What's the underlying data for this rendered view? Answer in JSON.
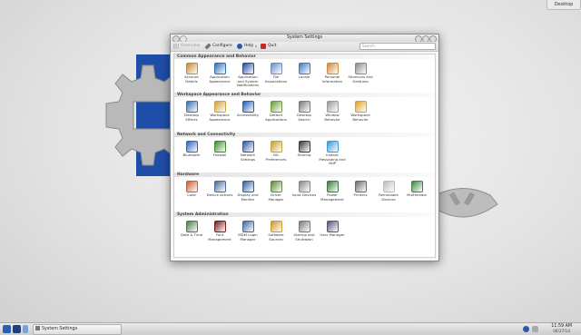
{
  "desktop": {
    "desktop_button": "Desktop"
  },
  "window": {
    "title": "System Settings",
    "toolbar": {
      "overview": "Overview",
      "configure": "Configure",
      "help": "Help",
      "quit": "Quit",
      "search_placeholder": "Search"
    },
    "sections": [
      {
        "title": "Common Appearance and Behavior",
        "items": [
          {
            "label": "Account Details",
            "icon": "user-icon",
            "color": "#c98a2e"
          },
          {
            "label": "Application Appearance",
            "icon": "palette-icon",
            "color": "#2f6eb8"
          },
          {
            "label": "Application and System Notifications",
            "icon": "info-icon",
            "color": "#1c4fa0"
          },
          {
            "label": "File Associations",
            "icon": "file-assoc-icon",
            "color": "#6a8fc7"
          },
          {
            "label": "Locale",
            "icon": "globe-icon",
            "color": "#3a7ac9"
          },
          {
            "label": "Personal Information",
            "icon": "person-icon",
            "color": "#d08a3a"
          },
          {
            "label": "Shortcuts and Gestures",
            "icon": "keyboard-icon",
            "color": "#8a8a8a"
          }
        ]
      },
      {
        "title": "Workspace Appearance and Behavior",
        "items": [
          {
            "label": "Desktop Effects",
            "icon": "desktop-effects-icon",
            "color": "#3c6fb3"
          },
          {
            "label": "Workspace Appearance",
            "icon": "workspace-appearance-icon",
            "color": "#d0a040"
          },
          {
            "label": "Accessibility",
            "icon": "accessibility-icon",
            "color": "#1f5fb8"
          },
          {
            "label": "Default Applications",
            "icon": "default-apps-icon",
            "color": "#6d9a3a"
          },
          {
            "label": "Desktop Search",
            "icon": "magnifier-icon",
            "color": "#7a7a7a"
          },
          {
            "label": "Window Behavior",
            "icon": "window-icon",
            "color": "#9a9a9a"
          },
          {
            "label": "Workspace Behavior",
            "icon": "workspace-behavior-icon",
            "color": "#e0a020"
          }
        ]
      },
      {
        "title": "Network and Connectivity",
        "items": [
          {
            "label": "Bluetooth",
            "icon": "bluetooth-icon",
            "color": "#2b63c4"
          },
          {
            "label": "Firewall",
            "icon": "firewall-icon",
            "color": "#3d8c2e"
          },
          {
            "label": "Network Settings",
            "icon": "network-icon",
            "color": "#2a5aa6"
          },
          {
            "label": "SSL Preferences",
            "icon": "ssl-icon",
            "color": "#c4a030"
          },
          {
            "label": "Sharing",
            "icon": "sharing-icon",
            "color": "#3a3a3a"
          },
          {
            "label": "Instant Messaging and VoIP",
            "icon": "chat-icon",
            "color": "#3a9ad9"
          }
        ]
      },
      {
        "title": "Hardware",
        "items": [
          {
            "label": "Color",
            "icon": "color-icon",
            "color": "#d05a2a"
          },
          {
            "label": "Device Actions",
            "icon": "device-actions-icon",
            "color": "#4a6a9a"
          },
          {
            "label": "Display and Monitor",
            "icon": "monitor-icon",
            "color": "#2a5f9e"
          },
          {
            "label": "Driver Manager",
            "icon": "driver-icon",
            "color": "#5a8a3a"
          },
          {
            "label": "Input Devices",
            "icon": "input-devices-icon",
            "color": "#888888"
          },
          {
            "label": "Power Management",
            "icon": "power-icon",
            "color": "#3a7a3a"
          },
          {
            "label": "Printers",
            "icon": "printer-icon",
            "color": "#6a6a6a"
          },
          {
            "label": "Removable Devices",
            "icon": "removable-icon",
            "color": "#bbbbbb"
          },
          {
            "label": "Multimedia",
            "icon": "multimedia-icon",
            "color": "#3a8a3a"
          }
        ]
      },
      {
        "title": "System Administration",
        "items": [
          {
            "label": "Date & Time",
            "icon": "clock-icon",
            "color": "#4a7a4a"
          },
          {
            "label": "Font Management",
            "icon": "font-icon",
            "color": "#7a1a1a"
          },
          {
            "label": "MDM Login Manager",
            "icon": "login-manager-icon",
            "color": "#3a6aa6"
          },
          {
            "label": "Software Sources",
            "icon": "software-sources-icon",
            "color": "#c79a2a"
          },
          {
            "label": "Startup and Shutdown",
            "icon": "startup-icon",
            "color": "#7a7a7a"
          },
          {
            "label": "User Manager",
            "icon": "user-manager-icon",
            "color": "#555577"
          }
        ]
      }
    ]
  },
  "taskbar": {
    "task": "System Settings",
    "time": "11:59 AM",
    "date": "06/27/14"
  }
}
